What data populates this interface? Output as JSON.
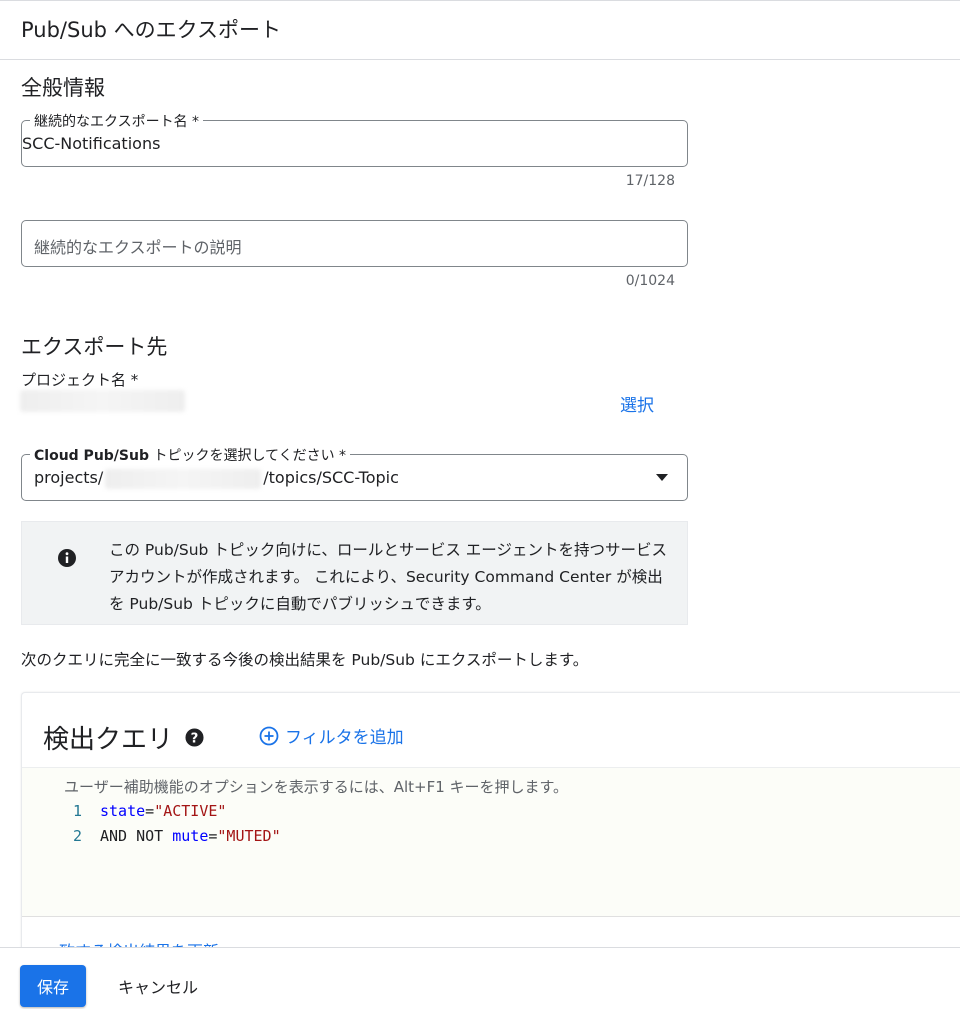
{
  "header": {
    "title": "Pub/Sub へのエクスポート"
  },
  "general": {
    "section_title": "全般情報",
    "name_field": {
      "label": "継続的なエクスポート名 *",
      "value": "SCC-Notifications",
      "counter": "17/128"
    },
    "description_field": {
      "placeholder": "継続的なエクスポートの説明",
      "counter": "0/1024"
    }
  },
  "destination": {
    "section_title": "エクスポート先",
    "project_label": "プロジェクト名 *",
    "select_link": "選択",
    "topic_field": {
      "label_bold": "Cloud Pub/Sub",
      "label_rest": " トピックを選択してください *",
      "value_prefix": "projects/",
      "value_suffix": "/topics/SCC-Topic"
    },
    "info_text": "この Pub/Sub トピック向けに、ロールとサービス エージェントを持つサービス アカウントが作成されます。 これにより、Security Command Center が検出を Pub/Sub トピックに自動でパブリッシュできます。"
  },
  "query_description": "次のクエリに完全に一致する今後の検出結果を Pub/Sub にエクスポートします。",
  "query": {
    "title": "検出クエリ",
    "add_filter": "フィルタを追加",
    "editor_hint": "ユーザー補助機能のオプションを表示するには、Alt+F1 キーを押します。",
    "lines": [
      {
        "num": "1",
        "prefix": "",
        "key": "state",
        "eq": "=",
        "value": "\"ACTIVE\""
      },
      {
        "num": "2",
        "prefix": "AND NOT ",
        "key": "mute",
        "eq": "=",
        "value": "\"MUTED\""
      }
    ],
    "refresh_link": "一致する検出結果を更新"
  },
  "footer": {
    "save_label": "保存",
    "cancel_label": "キャンセル"
  },
  "colors": {
    "accent": "#1a73e8",
    "keyword": "#0000ff",
    "string": "#a31515",
    "line_number": "#237893"
  }
}
